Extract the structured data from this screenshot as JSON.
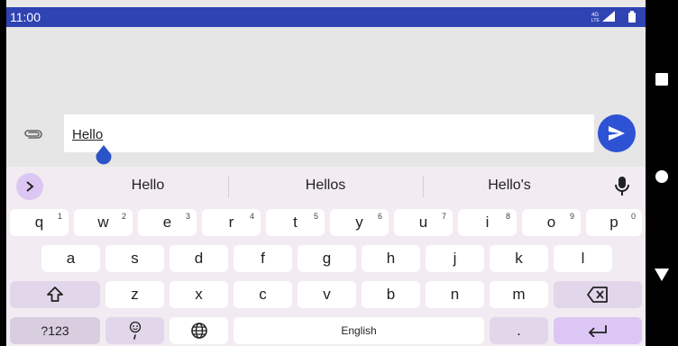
{
  "status_bar": {
    "time": "11:00",
    "network": "4G LTE"
  },
  "composer": {
    "text": "Hello",
    "attach_icon": "paperclip-icon",
    "send_icon": "send-icon"
  },
  "suggestions": [
    "Hello",
    "Hellos",
    "Hello's"
  ],
  "keyboard": {
    "row1": [
      {
        "k": "q",
        "n": "1"
      },
      {
        "k": "w",
        "n": "2"
      },
      {
        "k": "e",
        "n": "3"
      },
      {
        "k": "r",
        "n": "4"
      },
      {
        "k": "t",
        "n": "5"
      },
      {
        "k": "y",
        "n": "6"
      },
      {
        "k": "u",
        "n": "7"
      },
      {
        "k": "i",
        "n": "8"
      },
      {
        "k": "o",
        "n": "9"
      },
      {
        "k": "p",
        "n": "0"
      }
    ],
    "row2": [
      "a",
      "s",
      "d",
      "f",
      "g",
      "h",
      "j",
      "k",
      "l"
    ],
    "row3": [
      "z",
      "x",
      "c",
      "v",
      "b",
      "n",
      "m"
    ],
    "symbols_label": "?123",
    "space_label": "English",
    "period_label": "."
  },
  "colors": {
    "status_bar": "#3043b3",
    "send_button": "#2d53d4",
    "accent_key": "#dcc7f4"
  }
}
